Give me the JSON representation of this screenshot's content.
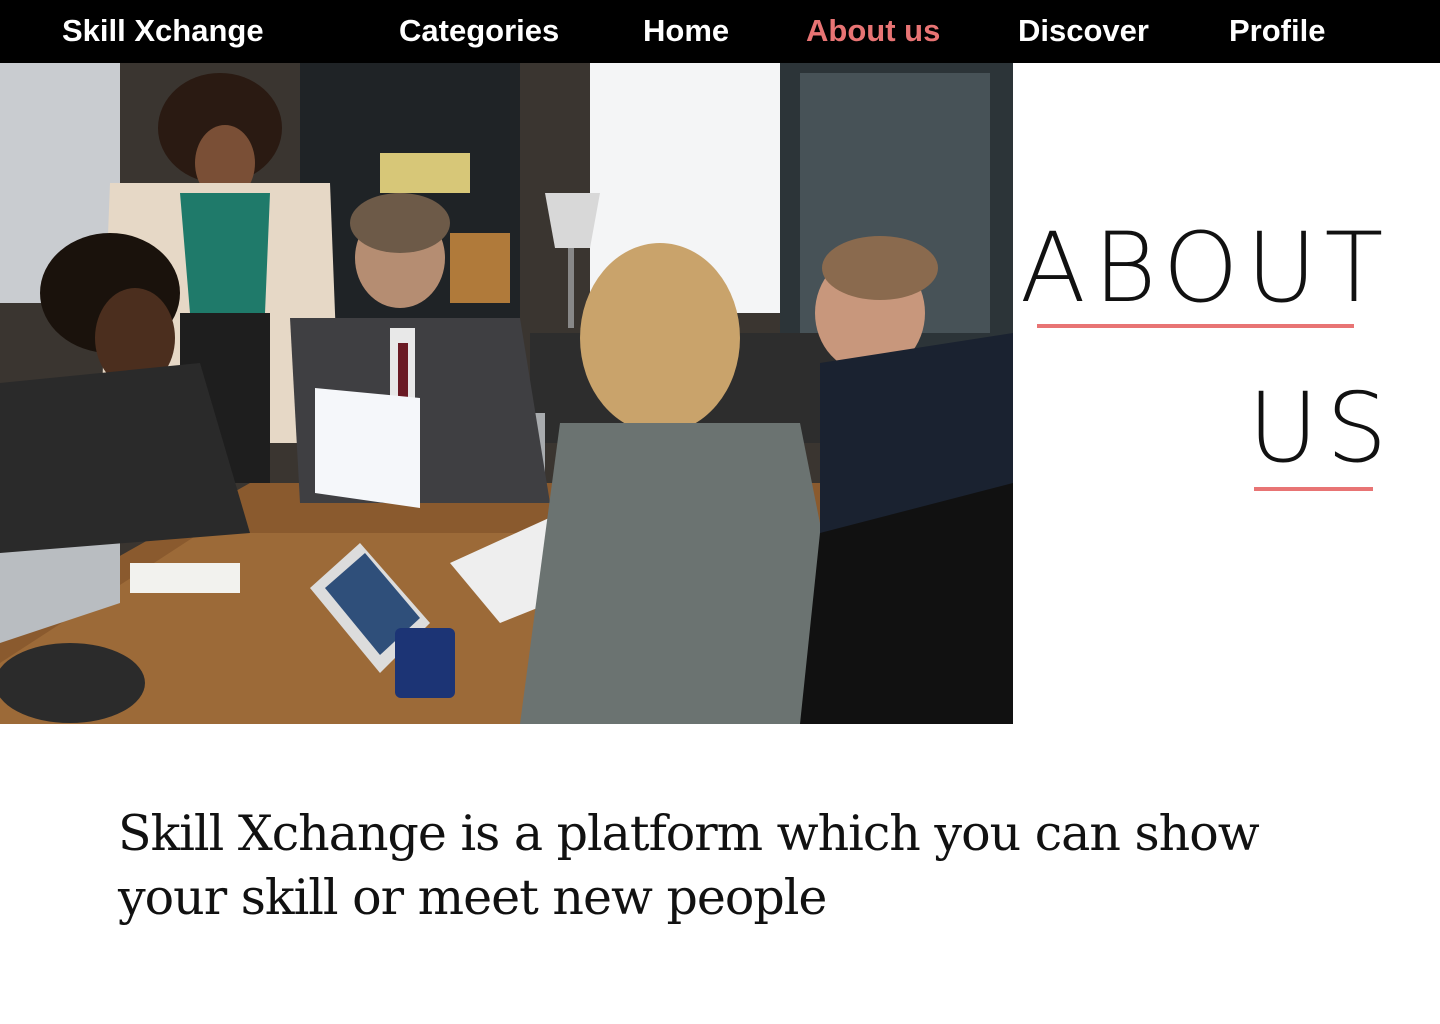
{
  "nav": {
    "brand": "Skill Xchange",
    "items": [
      {
        "label": "Categories"
      },
      {
        "label": "Home"
      },
      {
        "label": "About us"
      },
      {
        "label": "Discover"
      },
      {
        "label": "Profile"
      }
    ],
    "active_index": 2
  },
  "hero": {
    "photo_subject": "team-meeting-photo"
  },
  "about": {
    "heading_line1": "ABOUT",
    "heading_line2": "US",
    "description": "Skill Xchange is a platform which you can show your skill or meet new people"
  },
  "colors": {
    "nav_background": "#000000",
    "nav_text": "#ffffff",
    "accent": "#e87474",
    "heading_text": "#111111"
  }
}
